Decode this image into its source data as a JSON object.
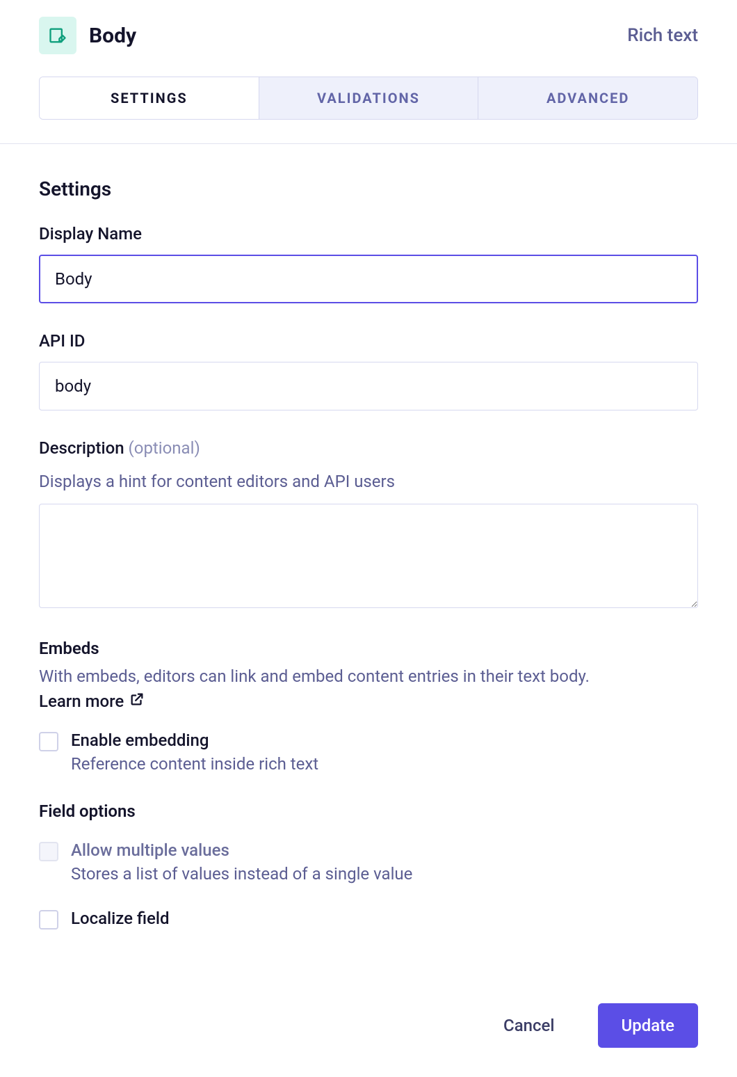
{
  "header": {
    "title": "Body",
    "field_type": "Rich text"
  },
  "tabs": [
    {
      "label": "SETTINGS",
      "active": true
    },
    {
      "label": "VALIDATIONS",
      "active": false
    },
    {
      "label": "ADVANCED",
      "active": false
    }
  ],
  "settings": {
    "heading": "Settings",
    "display_name": {
      "label": "Display Name",
      "value": "Body"
    },
    "api_id": {
      "label": "API ID",
      "value": "body"
    },
    "description": {
      "label": "Description",
      "optional_tag": "(optional)",
      "hint": "Displays a hint for content editors and API users",
      "value": ""
    },
    "embeds": {
      "heading": "Embeds",
      "hint": "With embeds, editors can link and embed content entries in their text body.",
      "learn_more": "Learn more",
      "enable": {
        "label": "Enable embedding",
        "hint": "Reference content inside rich text",
        "checked": false
      }
    },
    "field_options": {
      "heading": "Field options",
      "allow_multiple": {
        "label": "Allow multiple values",
        "hint": "Stores a list of values instead of a single value",
        "checked": false,
        "disabled": true
      },
      "localize": {
        "label": "Localize field",
        "checked": false
      }
    }
  },
  "footer": {
    "cancel": "Cancel",
    "update": "Update"
  }
}
